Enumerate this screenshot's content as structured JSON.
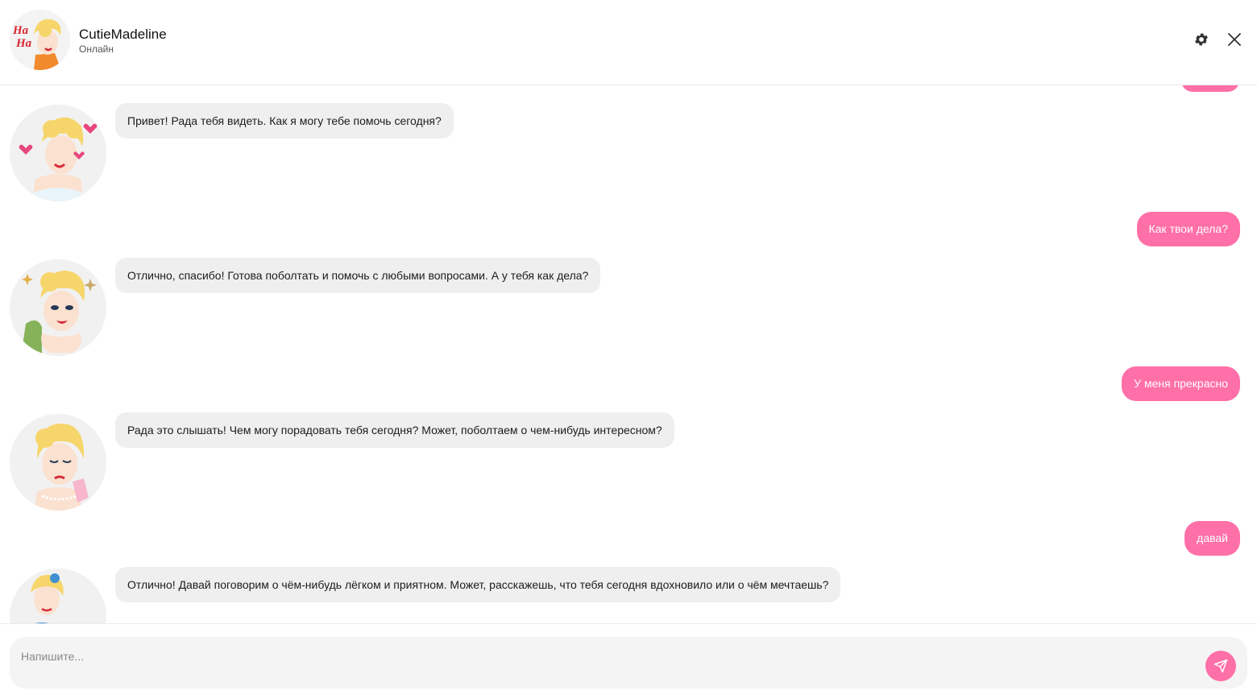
{
  "header": {
    "title": "CutieMadeline",
    "status": "Онлайн",
    "avatar_icon": "avatar-pinup-orange-icon",
    "settings_icon": "gear-icon",
    "close_icon": "close-icon"
  },
  "messages": [
    {
      "from": "bot",
      "text": "Привет! Рада тебя видеть. Как я могу тебе помочь сегодня?",
      "avatar": "sticker-hearts"
    },
    {
      "from": "user",
      "text": "Как твои дела?"
    },
    {
      "from": "bot",
      "text": "Отлично, спасибо! Готова поболтать и помочь с любыми вопросами. А у тебя как дела?",
      "avatar": "sticker-dreamy"
    },
    {
      "from": "user",
      "text": "У меня прекрасно"
    },
    {
      "from": "bot",
      "text": "Рада это слышать! Чем могу порадовать тебя сегодня? Может, поболтаем о чем-нибудь интересном?",
      "avatar": "sticker-tissue"
    },
    {
      "from": "user",
      "text": "давай"
    },
    {
      "from": "bot",
      "text": "Отлично! Давай поговорим о чём-нибудь лёгком и приятном. Может, расскажешь, что тебя сегодня вдохновило или о чём мечтаешь?",
      "avatar": "sticker-thinking"
    }
  ],
  "composer": {
    "placeholder": "Напишите...",
    "value": "",
    "send_icon": "send-icon"
  },
  "colors": {
    "accent": "#ff6fa8",
    "bot_bubble": "#efefef",
    "input_bg": "#f4f4f4"
  }
}
